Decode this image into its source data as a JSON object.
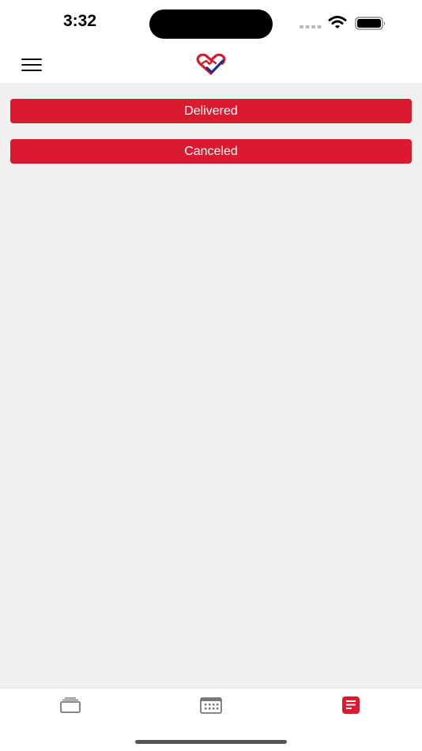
{
  "status_bar": {
    "time": "3:32",
    "wifi_icon": "wifi-icon",
    "battery_icon": "battery-icon",
    "signal_icon": "cellular-signal-icon"
  },
  "nav": {
    "menu_icon": "hamburger-menu-icon",
    "logo_icon": "heart-check-logo-icon"
  },
  "filters": {
    "delivered_label": "Delivered",
    "canceled_label": "Canceled"
  },
  "tabs": [
    {
      "icon": "stacked-cards-icon",
      "selected": false
    },
    {
      "icon": "calendar-icon",
      "selected": false
    },
    {
      "icon": "document-icon",
      "selected": true
    }
  ],
  "colors": {
    "accent": "#da1a2e",
    "background": "#f0f0f0",
    "logo_blue": "#1f2e8c",
    "inactive_icon": "#777777"
  }
}
